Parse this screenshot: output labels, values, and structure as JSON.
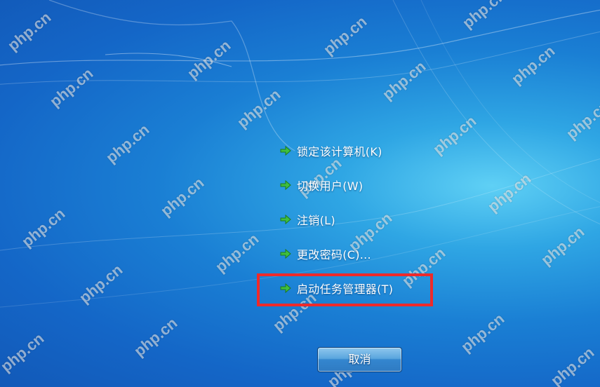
{
  "menu": {
    "items": [
      {
        "label": "锁定该计算机(K)",
        "icon": "green-arrow-icon"
      },
      {
        "label": "切换用户(W)",
        "icon": "green-arrow-icon"
      },
      {
        "label": "注销(L)",
        "icon": "green-arrow-icon"
      },
      {
        "label": "更改密码(C)...",
        "icon": "green-arrow-icon"
      },
      {
        "label": "启动任务管理器(T)",
        "icon": "green-arrow-icon"
      }
    ]
  },
  "cancel_button": {
    "label": "取消"
  },
  "watermark": {
    "text": "php.cn"
  },
  "colors": {
    "background": "#1a7fd4",
    "highlight": "#ee2a2a",
    "arrow": "#3fbf3f"
  }
}
